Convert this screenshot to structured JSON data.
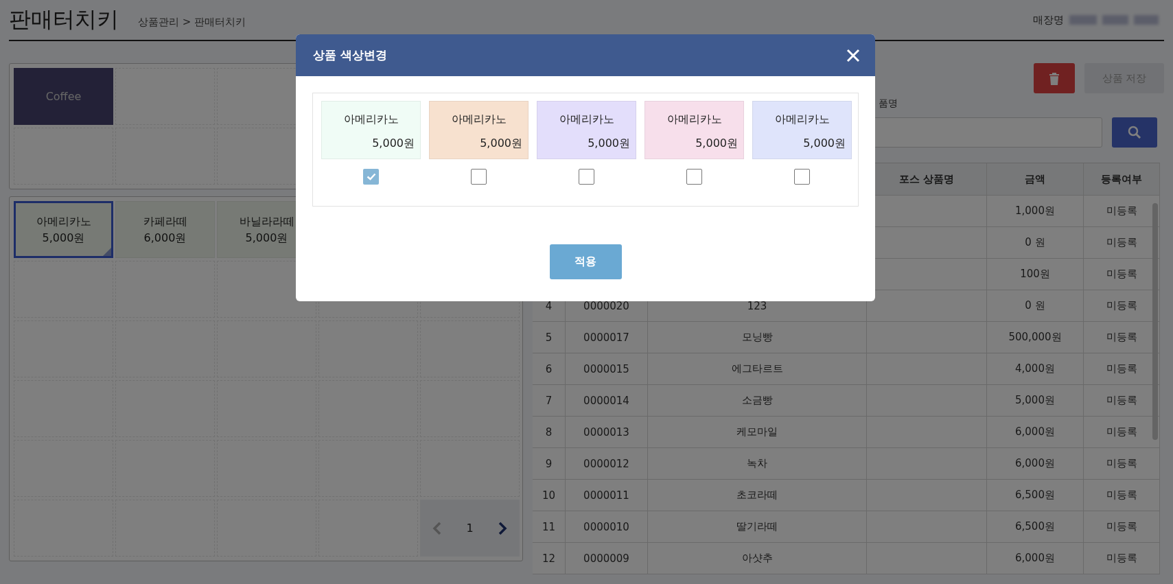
{
  "header": {
    "title": "판매터치키",
    "breadcrumb": "상품관리 > 판매터치키",
    "store_label": "매장명"
  },
  "categories": [
    {
      "label": "Coffee",
      "selected": true
    }
  ],
  "products": [
    {
      "name": "아메리카노",
      "price": "5,000원",
      "selected": true
    },
    {
      "name": "카페라떼",
      "price": "6,000원",
      "selected": false
    },
    {
      "name": "바닐라라떼",
      "price": "5,000원",
      "selected": false
    }
  ],
  "pager": {
    "page": "1",
    "prev_disabled": true,
    "next_disabled": false
  },
  "toolbar": {
    "save_label": "상품 저장"
  },
  "search": {
    "label": "품명"
  },
  "table": {
    "columns": [
      null,
      null,
      null,
      "포스 상품명",
      "금액",
      "등록여부"
    ],
    "rows": [
      {
        "cells": [
          null,
          null,
          null,
          "",
          "1,000원",
          "미등록"
        ]
      },
      {
        "cells": [
          null,
          null,
          null,
          "",
          "0 원",
          "미등록"
        ]
      },
      {
        "cells": [
          null,
          null,
          null,
          "",
          "100원",
          "미등록"
        ]
      },
      {
        "cells": [
          "4",
          "0000020",
          "123",
          "",
          "0 원",
          "미등록"
        ]
      },
      {
        "cells": [
          "5",
          "0000017",
          "모닝빵",
          "",
          "500,000원",
          "미등록"
        ]
      },
      {
        "cells": [
          "6",
          "0000015",
          "에그타르트",
          "",
          "4,000원",
          "미등록"
        ]
      },
      {
        "cells": [
          "7",
          "0000014",
          "소금빵",
          "",
          "5,000원",
          "미등록"
        ]
      },
      {
        "cells": [
          "8",
          "0000013",
          "케모마일",
          "",
          "6,000원",
          "미등록"
        ]
      },
      {
        "cells": [
          "9",
          "0000012",
          "녹차",
          "",
          "6,000원",
          "미등록"
        ]
      },
      {
        "cells": [
          "10",
          "0000011",
          "초코라떼",
          "",
          "6,500원",
          "미등록"
        ]
      },
      {
        "cells": [
          "11",
          "0000010",
          "딸기라떼",
          "",
          "6,500원",
          "미등록"
        ]
      },
      {
        "cells": [
          "12",
          "0000009",
          "아샷추",
          "",
          "6,000원",
          "미등록"
        ]
      }
    ]
  },
  "modal": {
    "title": "상품 색상변경",
    "apply_label": "적용",
    "swatches": [
      {
        "name": "아메리카노",
        "price": "5,000원",
        "color": "#f0fcf6",
        "checked": true
      },
      {
        "name": "아메리카노",
        "price": "5,000원",
        "color": "#f7e1cf",
        "checked": false
      },
      {
        "name": "아메리카노",
        "price": "5,000원",
        "color": "#e3defb",
        "checked": false
      },
      {
        "name": "아메리카노",
        "price": "5,000원",
        "color": "#f7dfeb",
        "checked": false
      },
      {
        "name": "아메리카노",
        "price": "5,000원",
        "color": "#dfe4fb",
        "checked": false
      }
    ]
  }
}
